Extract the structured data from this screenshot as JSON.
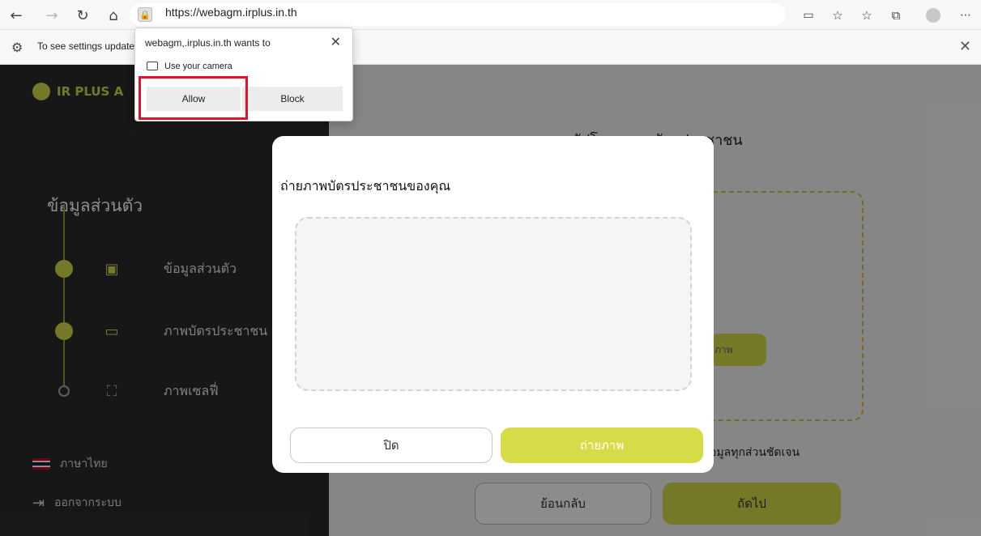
{
  "browser": {
    "url": "https://webagm.irplus.in.th",
    "infobar_text": "To see settings updates,",
    "icons": [
      "back-icon",
      "forward-icon",
      "refresh-icon",
      "home-icon",
      "lock-icon",
      "camera-blocked-icon",
      "favorite-add-icon",
      "favorites-icon",
      "collections-icon",
      "profile-icon",
      "more-icon",
      "settings-gear-icon",
      "close-icon"
    ]
  },
  "permission": {
    "title": "webagm,.irplus.in.th wants to",
    "camera_label": "Use your camera",
    "allow_label": "Allow",
    "block_label": "Block"
  },
  "sidebar": {
    "brand": "IR PLUS A",
    "section_title": "ข้อมูลส่วนตัว",
    "steps": [
      {
        "label": "ข้อมูลส่วนตัว",
        "completed": true
      },
      {
        "label": "ภาพบัตรประชาชน",
        "completed": true
      },
      {
        "label": "ภาพเซลฟี่",
        "completed": false
      }
    ],
    "language": "ภาษาไทย",
    "logout": "ออกจากระบบ"
  },
  "main": {
    "title": "อัปโหลดภาพบัตรประชาชน",
    "inner_button": "ภาพ",
    "hint": "อมูลทุกส่วนชัดเจน",
    "back_label": "ย้อนกลับ",
    "next_label": "ถัดไป"
  },
  "modal": {
    "title": "ถ่ายภาพบัตรประชาชนของคุณ",
    "close_label": "ปิด",
    "capture_label": "ถ่ายภาพ"
  },
  "colors": {
    "accent": "#d6dc48",
    "sidebar_bg": "#2b2b2b",
    "highlight": "#e0142a"
  }
}
